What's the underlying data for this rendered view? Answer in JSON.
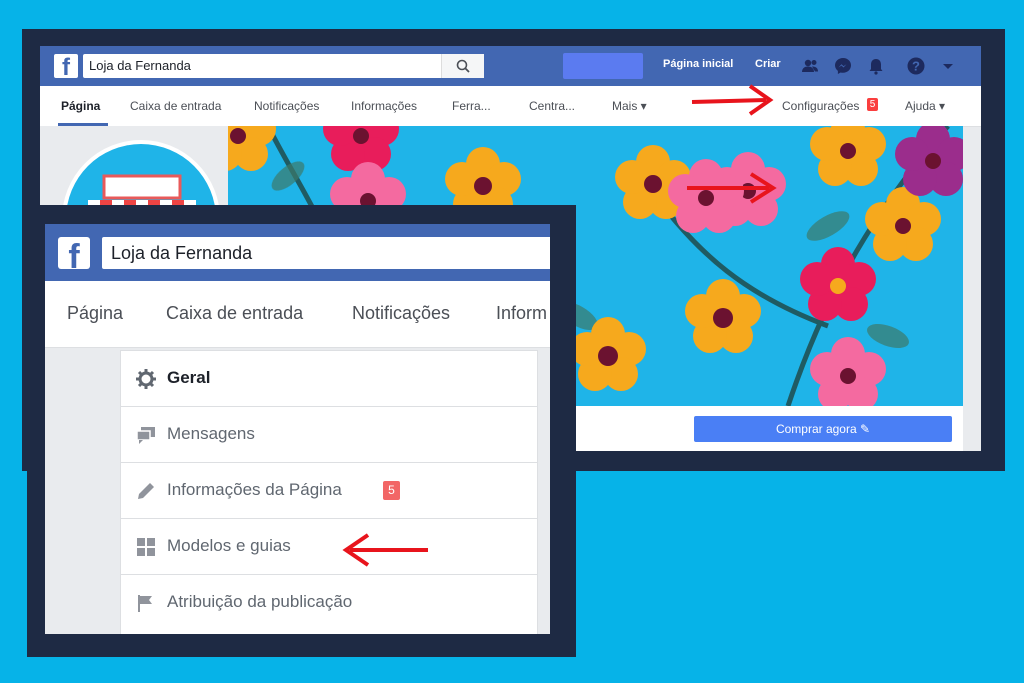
{
  "back_window": {
    "search_value": "Loja da Fernanda",
    "nav": {
      "home": "Página inicial",
      "create": "Criar"
    },
    "tabs": [
      "Página",
      "Caixa de entrada",
      "Notificações",
      "Informações",
      "Ferra...",
      "Centra...",
      "Mais ▾"
    ],
    "settings_label": "Configurações",
    "settings_badge": "5",
    "help_label": "Ajuda ▾",
    "cta_label": "Comprar agora ✎"
  },
  "front_window": {
    "search_value": "Loja da Fernanda",
    "tabs": [
      "Página",
      "Caixa de entrada",
      "Notificações",
      "Inform"
    ],
    "menu_items": [
      {
        "label": "Geral",
        "icon": "gear-icon"
      },
      {
        "label": "Mensagens",
        "icon": "chat-icon"
      },
      {
        "label": "Informações da Página",
        "icon": "pencil-icon",
        "badge": "5"
      },
      {
        "label": "Modelos e guias",
        "icon": "grid-icon"
      },
      {
        "label": "Atribuição da publicação",
        "icon": "flag-icon"
      }
    ]
  },
  "colors": {
    "background": "#06b3e8",
    "frame": "#1e2a44",
    "facebook_blue": "#4267b2",
    "arrow": "#e8141c",
    "cta": "#4a7ff5"
  }
}
